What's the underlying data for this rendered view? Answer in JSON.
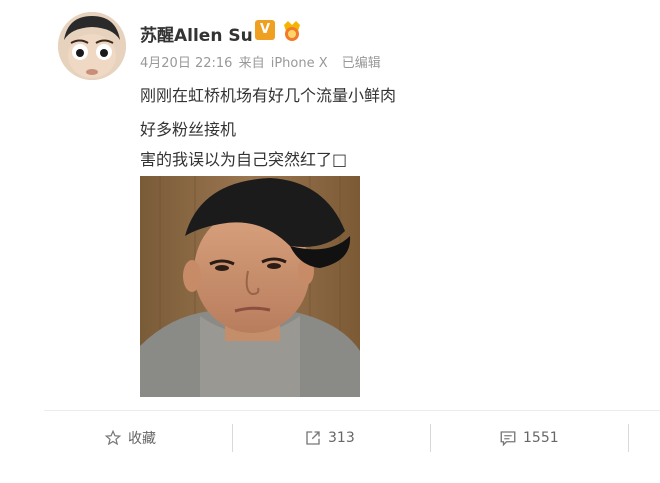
{
  "post": {
    "author": "苏醒Allen Su",
    "verified_badge": "V",
    "meta": {
      "date": "4月20日 22:16",
      "source_prefix": "来自",
      "source": "iPhone X",
      "edited": "已编辑"
    },
    "lines": [
      "刚刚在虹桥机场有好几个流量小鲜肉",
      "好多粉丝接机",
      "害的我误以为自己突然红了□"
    ]
  },
  "actions": {
    "favorite_label": "收藏",
    "repost_count": "313",
    "comment_count": "1551"
  },
  "colors": {
    "badge_orange": "#f0a020",
    "text_primary": "#333333",
    "text_meta": "#999999"
  },
  "icons": [
    "avatar",
    "verified-v-icon",
    "rank-badge-icon",
    "star-icon",
    "repost-icon",
    "comment-icon"
  ]
}
